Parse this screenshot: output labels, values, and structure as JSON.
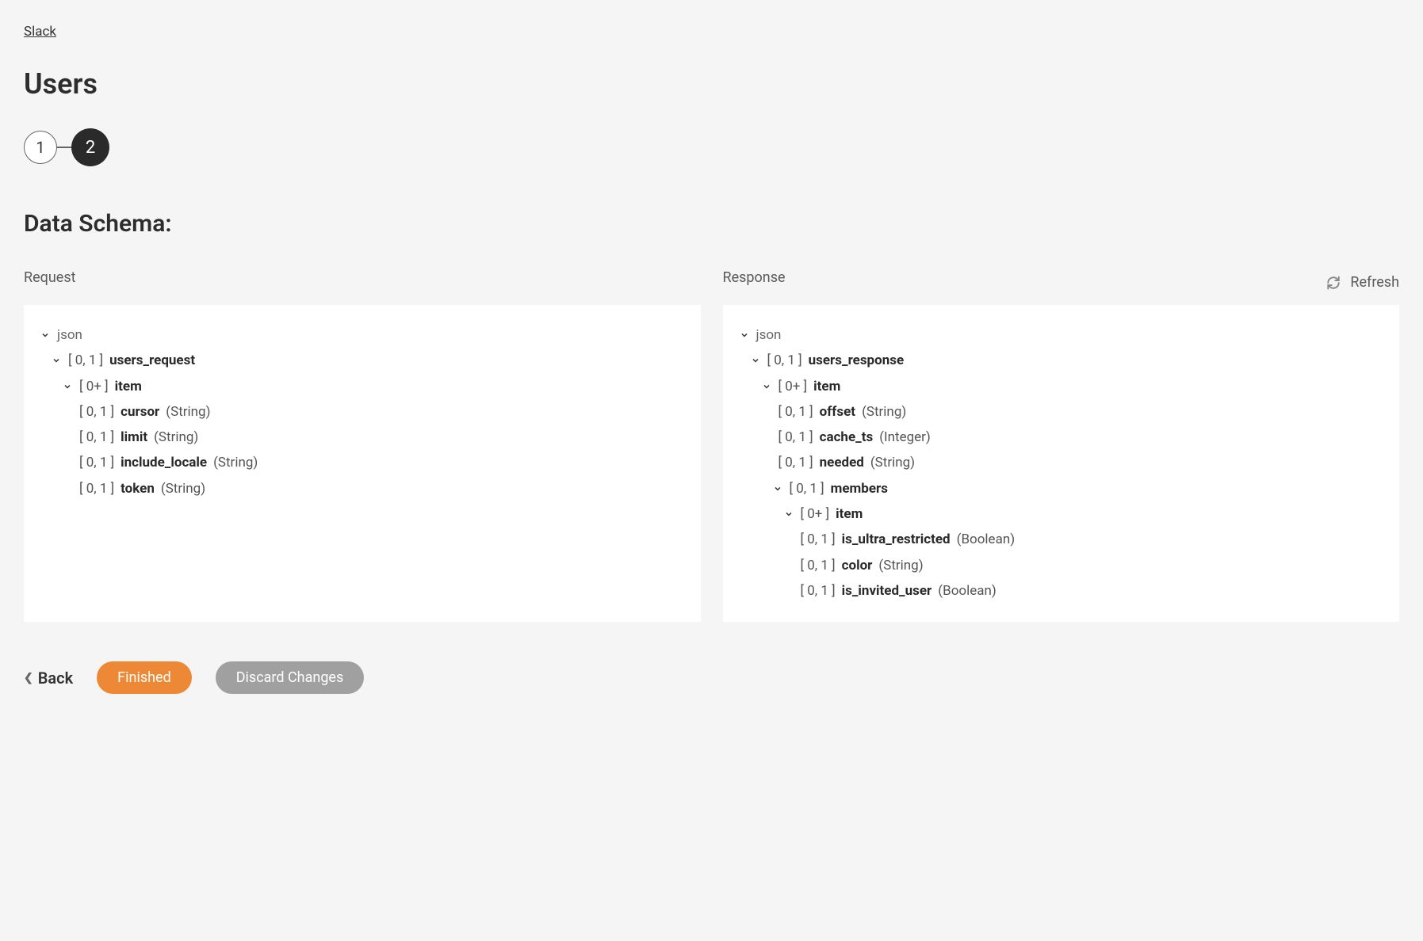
{
  "breadcrumb": {
    "label": "Slack"
  },
  "page": {
    "title": "Users"
  },
  "stepper": {
    "steps": [
      "1",
      "2"
    ],
    "active_index": 1
  },
  "section": {
    "title": "Data Schema:"
  },
  "refresh": {
    "label": "Refresh"
  },
  "columns": {
    "request": {
      "label": "Request",
      "root": "json",
      "tree": [
        {
          "indent": 2,
          "expandable": true,
          "card": "[ 0, 1 ]",
          "name": "users_request",
          "type": null
        },
        {
          "indent": 3,
          "expandable": true,
          "card": "[ 0+ ]",
          "name": "item",
          "type": null
        },
        {
          "indent": 4,
          "expandable": false,
          "card": "[ 0, 1 ]",
          "name": "cursor",
          "type": "(String)"
        },
        {
          "indent": 4,
          "expandable": false,
          "card": "[ 0, 1 ]",
          "name": "limit",
          "type": "(String)"
        },
        {
          "indent": 4,
          "expandable": false,
          "card": "[ 0, 1 ]",
          "name": "include_locale",
          "type": "(String)"
        },
        {
          "indent": 4,
          "expandable": false,
          "card": "[ 0, 1 ]",
          "name": "token",
          "type": "(String)"
        }
      ]
    },
    "response": {
      "label": "Response",
      "root": "json",
      "tree": [
        {
          "indent": 2,
          "expandable": true,
          "card": "[ 0, 1 ]",
          "name": "users_response",
          "type": null
        },
        {
          "indent": 3,
          "expandable": true,
          "card": "[ 0+ ]",
          "name": "item",
          "type": null
        },
        {
          "indent": 4,
          "expandable": false,
          "card": "[ 0, 1 ]",
          "name": "offset",
          "type": "(String)"
        },
        {
          "indent": 4,
          "expandable": false,
          "card": "[ 0, 1 ]",
          "name": "cache_ts",
          "type": "(Integer)"
        },
        {
          "indent": 4,
          "expandable": false,
          "card": "[ 0, 1 ]",
          "name": "needed",
          "type": "(String)"
        },
        {
          "indent": 5,
          "expandable": true,
          "card": "[ 0, 1 ]",
          "name": "members",
          "type": null
        },
        {
          "indent": 6,
          "expandable": true,
          "card": "[ 0+ ]",
          "name": "item",
          "type": null
        },
        {
          "indent": 7,
          "expandable": false,
          "card": "[ 0, 1 ]",
          "name": "is_ultra_restricted",
          "type": "(Boolean)"
        },
        {
          "indent": 7,
          "expandable": false,
          "card": "[ 0, 1 ]",
          "name": "color",
          "type": "(String)"
        },
        {
          "indent": 7,
          "expandable": false,
          "card": "[ 0, 1 ]",
          "name": "is_invited_user",
          "type": "(Boolean)"
        }
      ]
    }
  },
  "footer": {
    "back": "Back",
    "finished": "Finished",
    "discard": "Discard Changes"
  }
}
